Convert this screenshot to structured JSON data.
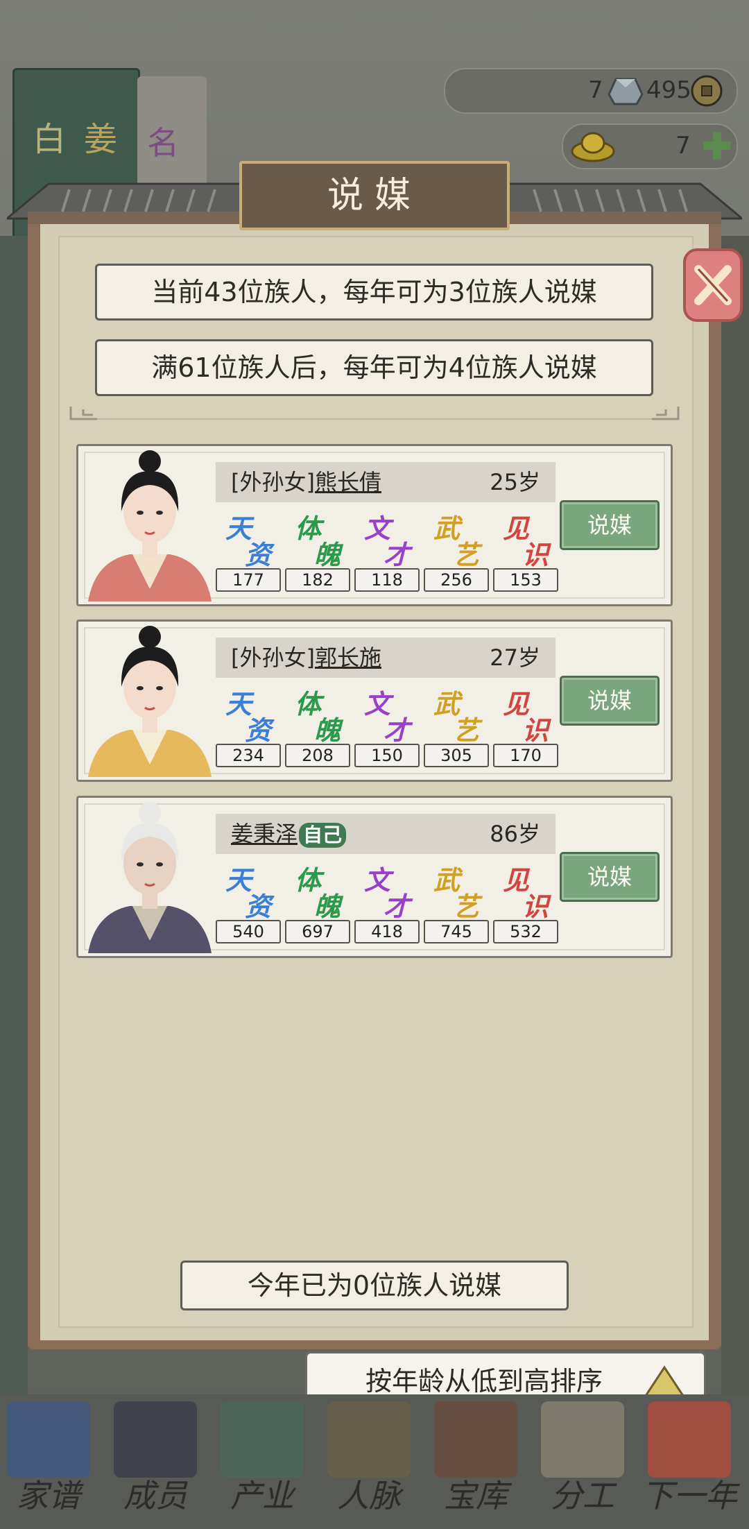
{
  "currency": {
    "silver_count": "7",
    "coin_count": "495",
    "gold_count": "7"
  },
  "bg_book": {
    "title_left": "白",
    "title_mid": "姜",
    "title_right": "名"
  },
  "dialog": {
    "title": "说媒",
    "info_line1": "当前43位族人，每年可为3位族人说媒",
    "info_line2": "满61位族人后，每年可为4位族人说媒",
    "footer": "今年已为0位族人说媒",
    "sort_label": "按年龄从低到高排序"
  },
  "stat_labels": [
    {
      "top": "天",
      "bottom": "资",
      "color": "#3a7fd6"
    },
    {
      "top": "体",
      "bottom": "魄",
      "color": "#2d9a4b"
    },
    {
      "top": "文",
      "bottom": "才",
      "color": "#9a3fc8"
    },
    {
      "top": "武",
      "bottom": "艺",
      "color": "#d2a020"
    },
    {
      "top": "见",
      "bottom": "识",
      "color": "#d2443e"
    }
  ],
  "members": [
    {
      "prefix": "[外孙女]",
      "name": "熊长倩",
      "self": "",
      "age": "25岁",
      "stats": [
        "177",
        "182",
        "118",
        "256",
        "153"
      ],
      "button": "说媒"
    },
    {
      "prefix": "[外孙女]",
      "name": "郭长施",
      "self": "",
      "age": "27岁",
      "stats": [
        "234",
        "208",
        "150",
        "305",
        "170"
      ],
      "button": "说媒"
    },
    {
      "prefix": "",
      "name": "姜秉泽",
      "self": "自己",
      "age": "86岁",
      "stats": [
        "540",
        "697",
        "418",
        "745",
        "532"
      ],
      "button": "说媒"
    }
  ],
  "nav": [
    {
      "label": "家谱",
      "icon": "family-tree-icon"
    },
    {
      "label": "成员",
      "icon": "member-icon"
    },
    {
      "label": "产业",
      "icon": "building-icon"
    },
    {
      "label": "人脉",
      "icon": "network-icon"
    },
    {
      "label": "宝库",
      "icon": "treasure-icon"
    },
    {
      "label": "分工",
      "icon": "scroll-icon"
    },
    {
      "label": "下一年",
      "icon": "lantern-icon"
    }
  ]
}
